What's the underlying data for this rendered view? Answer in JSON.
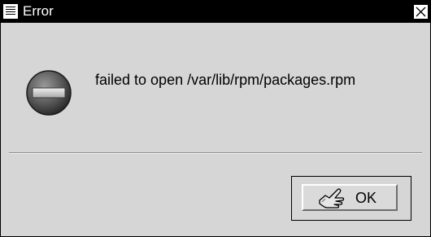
{
  "window": {
    "title": "Error"
  },
  "dialog": {
    "message": "failed to open /var/lib/rpm/packages.rpm",
    "icon": "stop-icon"
  },
  "buttons": {
    "ok_label": "OK",
    "ok_icon": "hand-pointer-icon"
  },
  "colors": {
    "titlebar": "#000000",
    "background": "#d6d6d6"
  }
}
